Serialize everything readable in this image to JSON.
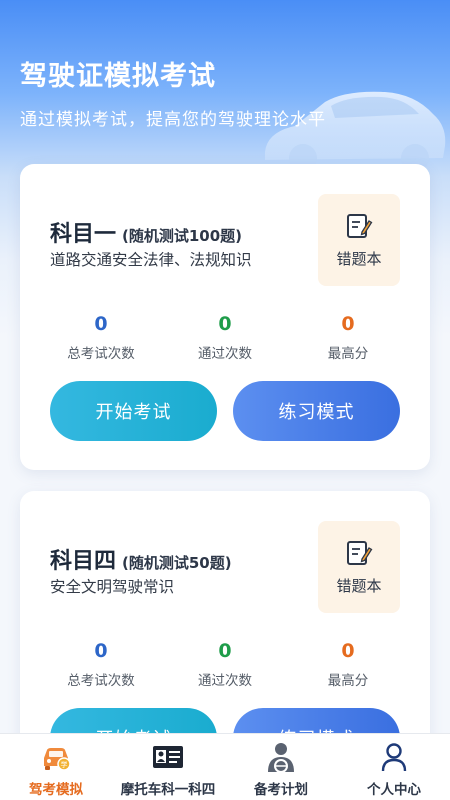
{
  "header": {
    "title": "驾驶证模拟考试",
    "subtitle": "通过模拟考试，提高您的驾驶理论水平"
  },
  "cards": [
    {
      "name": "科目一",
      "sub": "(随机测试100题)",
      "desc": "道路交通安全法律、法规知识",
      "wrong_label": "错题本",
      "stats": [
        {
          "value": "0",
          "label": "总考试次数"
        },
        {
          "value": "0",
          "label": "通过次数"
        },
        {
          "value": "0",
          "label": "最高分"
        }
      ],
      "start_label": "开始考试",
      "practice_label": "练习模式"
    },
    {
      "name": "科目四",
      "sub": "(随机测试50题)",
      "desc": "安全文明驾驶常识",
      "wrong_label": "错题本",
      "stats": [
        {
          "value": "0",
          "label": "总考试次数"
        },
        {
          "value": "0",
          "label": "通过次数"
        },
        {
          "value": "0",
          "label": "最高分"
        }
      ],
      "start_label": "开始考试",
      "practice_label": "练习模式"
    }
  ],
  "tabbar": {
    "items": [
      {
        "label": "驾考模拟",
        "icon": "car-icon",
        "active": true
      },
      {
        "label": "摩托车科一科四",
        "icon": "id-card-icon",
        "active": false
      },
      {
        "label": "备考计划",
        "icon": "driver-icon",
        "active": false
      },
      {
        "label": "个人中心",
        "icon": "person-icon",
        "active": false
      }
    ]
  },
  "colors": {
    "accent_orange": "#e56b1f",
    "stat_blue": "#2d66c8",
    "stat_green": "#1f9d4a",
    "btn_start": "#1aaccf",
    "btn_practice": "#3a6fe0"
  }
}
